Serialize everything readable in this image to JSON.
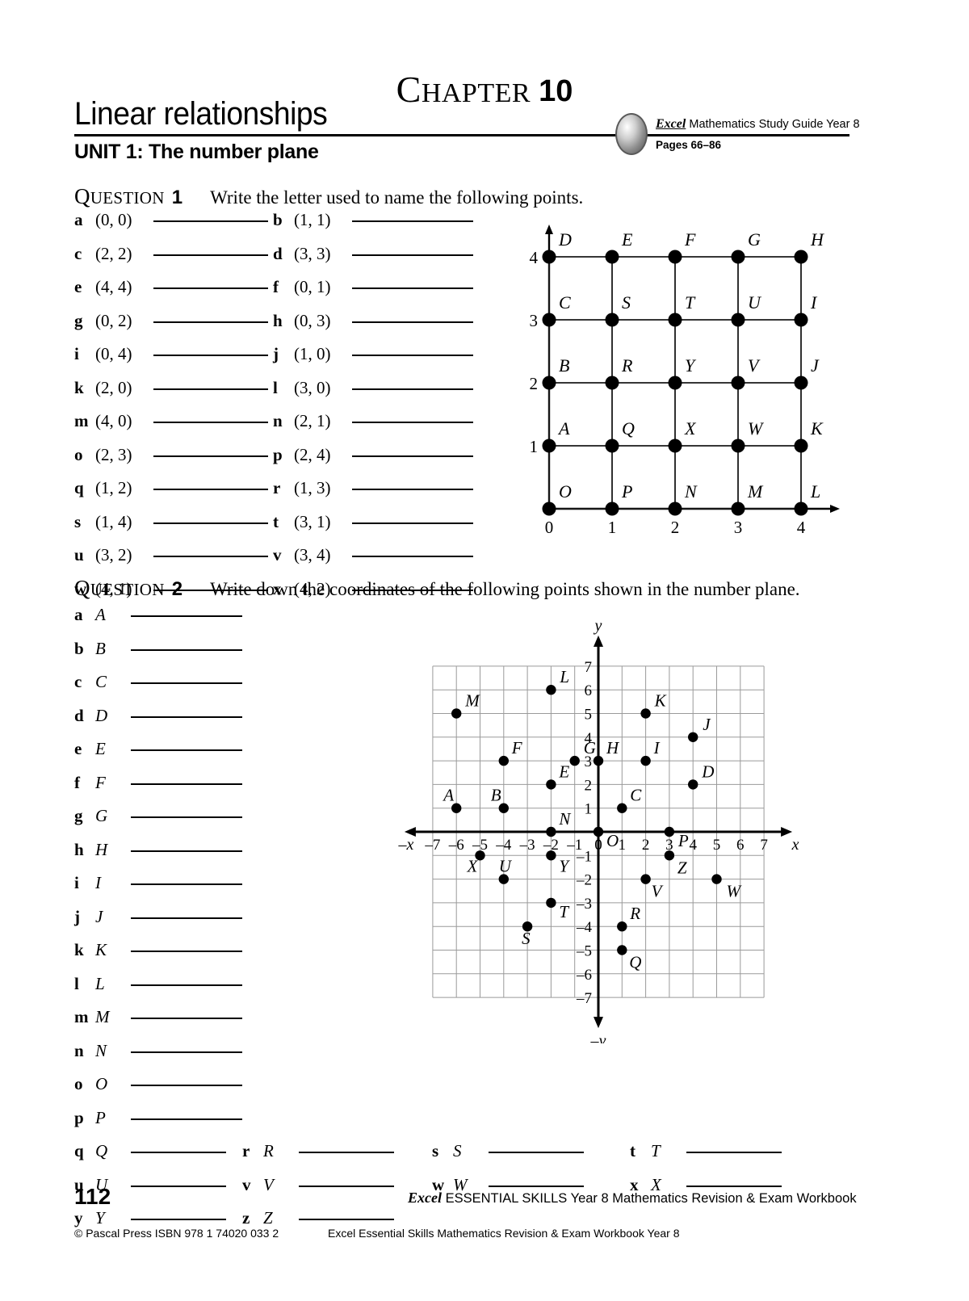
{
  "header": {
    "chapter_word": "HAPTER",
    "chapter_cap": "C",
    "chapter_number": "10",
    "title": "Linear relationships",
    "unit": "UNIT 1: The number plane",
    "badge_brand": "Excel",
    "badge_line1": "Mathematics Study Guide Year 8",
    "badge_line2": "Pages 66–86"
  },
  "question1": {
    "label_cap": "Q",
    "label_rest": "UESTION",
    "number": "1",
    "text": "Write the letter used to name the following points.",
    "items": [
      {
        "letter": "a",
        "coord": "(0, 0)"
      },
      {
        "letter": "b",
        "coord": "(1, 1)"
      },
      {
        "letter": "c",
        "coord": "(2, 2)"
      },
      {
        "letter": "d",
        "coord": "(3, 3)"
      },
      {
        "letter": "e",
        "coord": "(4, 4)"
      },
      {
        "letter": "f",
        "coord": "(0, 1)"
      },
      {
        "letter": "g",
        "coord": "(0, 2)"
      },
      {
        "letter": "h",
        "coord": "(0, 3)"
      },
      {
        "letter": "i",
        "coord": "(0, 4)"
      },
      {
        "letter": "j",
        "coord": "(1, 0)"
      },
      {
        "letter": "k",
        "coord": "(2, 0)"
      },
      {
        "letter": "l",
        "coord": "(3, 0)"
      },
      {
        "letter": "m",
        "coord": "(4, 0)"
      },
      {
        "letter": "n",
        "coord": "(2, 1)"
      },
      {
        "letter": "o",
        "coord": "(2, 3)"
      },
      {
        "letter": "p",
        "coord": "(2, 4)"
      },
      {
        "letter": "q",
        "coord": "(1, 2)"
      },
      {
        "letter": "r",
        "coord": "(1, 3)"
      },
      {
        "letter": "s",
        "coord": "(1, 4)"
      },
      {
        "letter": "t",
        "coord": "(3, 1)"
      },
      {
        "letter": "u",
        "coord": "(3, 2)"
      },
      {
        "letter": "v",
        "coord": "(3, 4)"
      },
      {
        "letter": "w",
        "coord": "(4, 1)"
      },
      {
        "letter": "x",
        "coord": "(4, 2)"
      }
    ]
  },
  "question2": {
    "label_cap": "Q",
    "label_rest": "UESTION",
    "number": "2",
    "text": "Write down the coordinates of the following points shown in the number plane.",
    "items": [
      {
        "letter": "a",
        "point": "A"
      },
      {
        "letter": "b",
        "point": "B"
      },
      {
        "letter": "c",
        "point": "C"
      },
      {
        "letter": "d",
        "point": "D"
      },
      {
        "letter": "e",
        "point": "E"
      },
      {
        "letter": "f",
        "point": "F"
      },
      {
        "letter": "g",
        "point": "G"
      },
      {
        "letter": "h",
        "point": "H"
      },
      {
        "letter": "i",
        "point": "I"
      },
      {
        "letter": "j",
        "point": "J"
      },
      {
        "letter": "k",
        "point": "K"
      },
      {
        "letter": "l",
        "point": "L"
      },
      {
        "letter": "m",
        "point": "M"
      },
      {
        "letter": "n",
        "point": "N"
      },
      {
        "letter": "o",
        "point": "O"
      },
      {
        "letter": "p",
        "point": "P"
      },
      {
        "letter": "q",
        "point": "Q"
      },
      {
        "letter": "r",
        "point": "R"
      },
      {
        "letter": "s",
        "point": "S"
      },
      {
        "letter": "t",
        "point": "T"
      },
      {
        "letter": "u",
        "point": "U"
      },
      {
        "letter": "v",
        "point": "V"
      },
      {
        "letter": "w",
        "point": "W"
      },
      {
        "letter": "x",
        "point": "X"
      },
      {
        "letter": "y",
        "point": "Y"
      },
      {
        "letter": "z",
        "point": "Z"
      }
    ]
  },
  "chart_data": [
    {
      "type": "scatter",
      "name": "question-1-lattice-grid",
      "title": "",
      "xlabel": "",
      "ylabel": "",
      "xlim": [
        0,
        4
      ],
      "ylim": [
        0,
        4
      ],
      "xticks": [
        "0",
        "1",
        "2",
        "3",
        "4"
      ],
      "yticks": [
        "1",
        "2",
        "3",
        "4"
      ],
      "grid": true,
      "points": [
        {
          "label": "O",
          "x": 0,
          "y": 0
        },
        {
          "label": "P",
          "x": 1,
          "y": 0
        },
        {
          "label": "N",
          "x": 2,
          "y": 0
        },
        {
          "label": "M",
          "x": 3,
          "y": 0
        },
        {
          "label": "L",
          "x": 4,
          "y": 0
        },
        {
          "label": "A",
          "x": 0,
          "y": 1
        },
        {
          "label": "Q",
          "x": 1,
          "y": 1
        },
        {
          "label": "X",
          "x": 2,
          "y": 1
        },
        {
          "label": "W",
          "x": 3,
          "y": 1
        },
        {
          "label": "K",
          "x": 4,
          "y": 1
        },
        {
          "label": "B",
          "x": 0,
          "y": 2
        },
        {
          "label": "R",
          "x": 1,
          "y": 2
        },
        {
          "label": "Y",
          "x": 2,
          "y": 2
        },
        {
          "label": "V",
          "x": 3,
          "y": 2
        },
        {
          "label": "J",
          "x": 4,
          "y": 2
        },
        {
          "label": "C",
          "x": 0,
          "y": 3
        },
        {
          "label": "S",
          "x": 1,
          "y": 3
        },
        {
          "label": "T",
          "x": 2,
          "y": 3
        },
        {
          "label": "U",
          "x": 3,
          "y": 3
        },
        {
          "label": "I",
          "x": 4,
          "y": 3
        },
        {
          "label": "D",
          "x": 0,
          "y": 4
        },
        {
          "label": "E",
          "x": 1,
          "y": 4
        },
        {
          "label": "F",
          "x": 2,
          "y": 4
        },
        {
          "label": "G",
          "x": 3,
          "y": 4
        },
        {
          "label": "H",
          "x": 4,
          "y": 4
        }
      ]
    },
    {
      "type": "scatter",
      "name": "question-2-number-plane",
      "title": "",
      "xlabel": "x",
      "ylabel": "y",
      "axis_neg_xlabel": "–x",
      "axis_neg_ylabel": "–y",
      "xlim": [
        -7,
        7
      ],
      "ylim": [
        -7,
        7
      ],
      "xticks": [
        "–7",
        "–6",
        "–5",
        "–4",
        "–3",
        "–2",
        "–1",
        "0",
        "1",
        "2",
        "3",
        "4",
        "5",
        "6",
        "7"
      ],
      "yticks": [
        "7",
        "6",
        "5",
        "4",
        "3",
        "2",
        "1",
        "–1",
        "–2",
        "–3",
        "–4",
        "–5",
        "–6",
        "–7"
      ],
      "grid": true,
      "points": [
        {
          "label": "A",
          "x": -6,
          "y": 1
        },
        {
          "label": "B",
          "x": -4,
          "y": 1
        },
        {
          "label": "C",
          "x": 1,
          "y": 1
        },
        {
          "label": "D",
          "x": 4,
          "y": 2
        },
        {
          "label": "E",
          "x": -2,
          "y": 2
        },
        {
          "label": "F",
          "x": -4,
          "y": 3
        },
        {
          "label": "G",
          "x": -1,
          "y": 3
        },
        {
          "label": "H",
          "x": 0,
          "y": 3
        },
        {
          "label": "I",
          "x": 2,
          "y": 3
        },
        {
          "label": "J",
          "x": 4,
          "y": 4
        },
        {
          "label": "K",
          "x": 2,
          "y": 5
        },
        {
          "label": "L",
          "x": -2,
          "y": 6
        },
        {
          "label": "M",
          "x": -6,
          "y": 5
        },
        {
          "label": "N",
          "x": -2,
          "y": 0
        },
        {
          "label": "O",
          "x": 0,
          "y": 0
        },
        {
          "label": "P",
          "x": 3,
          "y": 0
        },
        {
          "label": "Q",
          "x": 1,
          "y": -5
        },
        {
          "label": "R",
          "x": 1,
          "y": -4
        },
        {
          "label": "S",
          "x": -3,
          "y": -4
        },
        {
          "label": "T",
          "x": -2,
          "y": -3
        },
        {
          "label": "U",
          "x": -4,
          "y": -2
        },
        {
          "label": "V",
          "x": 2,
          "y": -2
        },
        {
          "label": "W",
          "x": 5,
          "y": -2
        },
        {
          "label": "X",
          "x": -5,
          "y": -1
        },
        {
          "label": "Y",
          "x": -2,
          "y": -1
        },
        {
          "label": "Z",
          "x": 3,
          "y": -1
        }
      ]
    }
  ],
  "footer": {
    "page_number": "112",
    "center_brand": "Excel",
    "center_text": "ESSENTIAL SKILLS Year 8 Mathematics Revision & Exam Workbook",
    "left": "© Pascal Press ISBN 978 1 74020 033 2",
    "right": "Excel Essential Skills Mathematics Revision & Exam Workbook Year 8"
  }
}
